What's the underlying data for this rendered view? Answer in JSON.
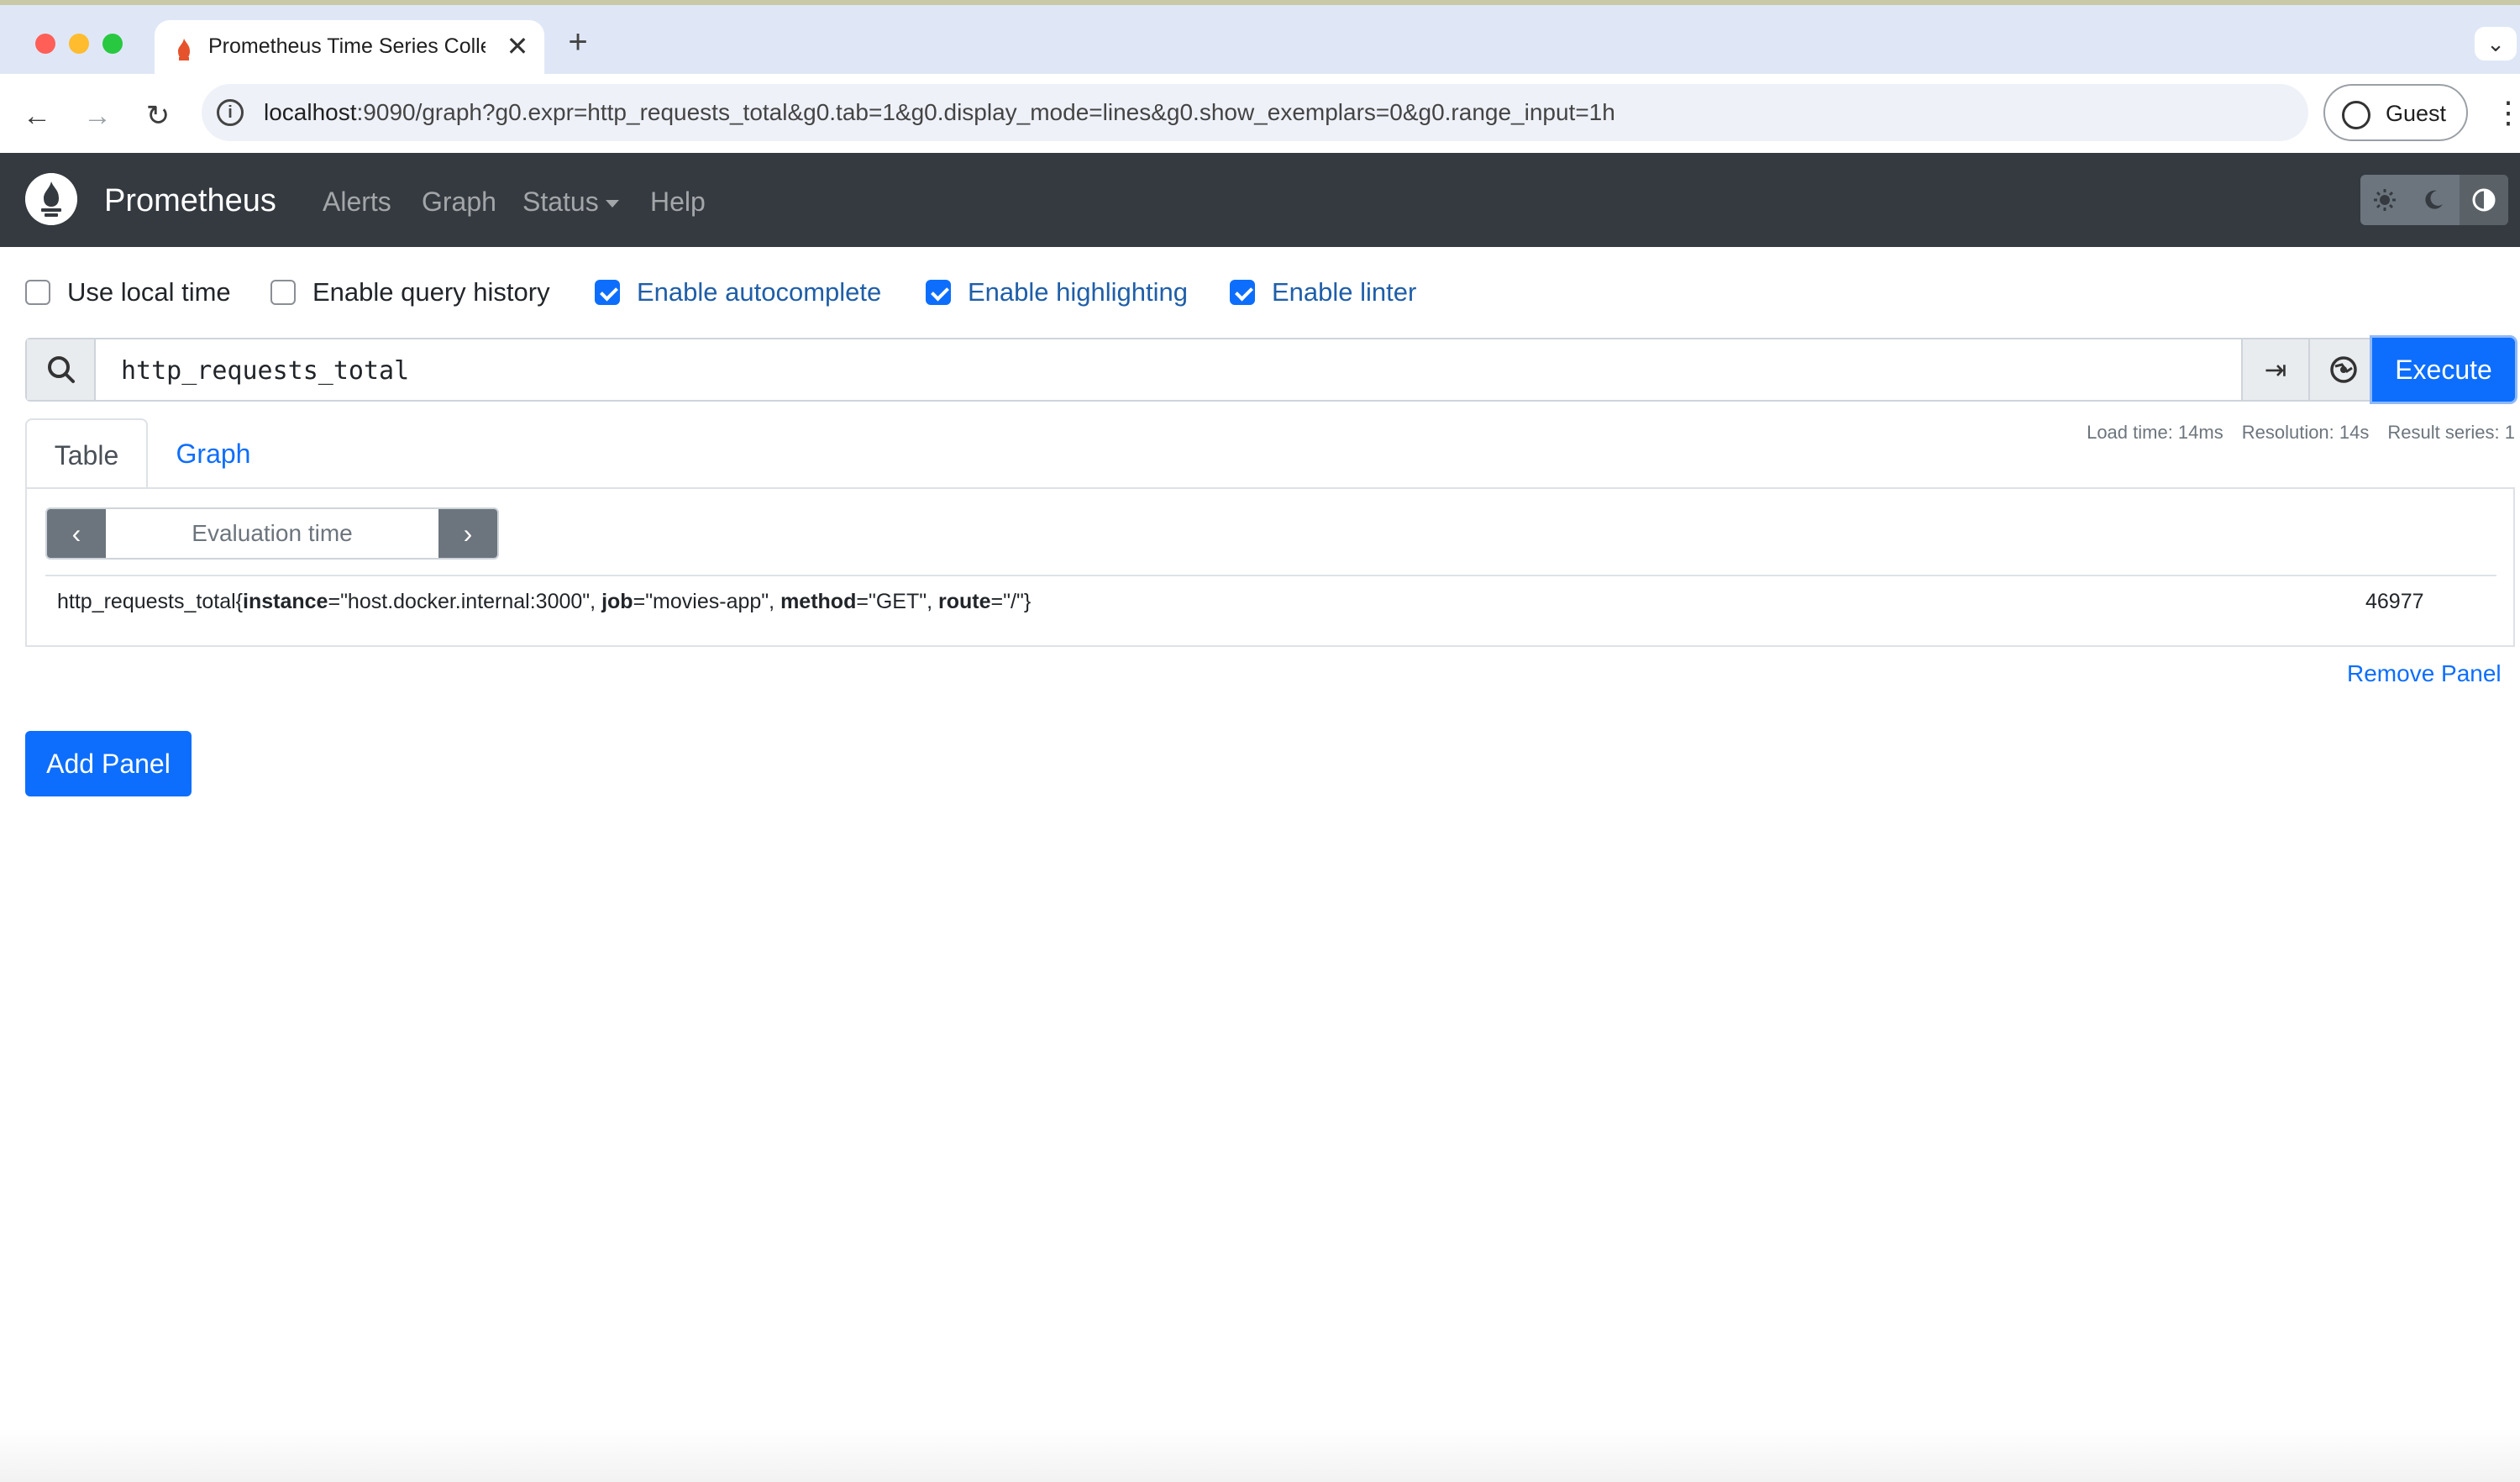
{
  "browser": {
    "tab_title": "Prometheus Time Series Collection and Processing Server",
    "tab_close": "✕",
    "new_tab": "+",
    "tab_menu": "⌄",
    "url_host": "localhost",
    "url_rest": ":9090/graph?g0.expr=http_requests_total&g0.tab=1&g0.display_mode=lines&g0.show_exemplars=0&g0.range_input=1h",
    "profile_label": "Guest",
    "info_glyph": "i",
    "menu_glyph": "⋮",
    "back_glyph": "←",
    "forward_glyph": "→",
    "reload_glyph": "↻"
  },
  "navbar": {
    "brand": "Prometheus",
    "links": [
      "Alerts",
      "Graph",
      "Status",
      "Help"
    ],
    "theme_icons": [
      "sun-icon",
      "moon-icon",
      "contrast-icon"
    ]
  },
  "options": [
    {
      "label": "Use local time",
      "checked": false
    },
    {
      "label": "Enable query history",
      "checked": false
    },
    {
      "label": "Enable autocomplete",
      "checked": true
    },
    {
      "label": "Enable highlighting",
      "checked": true
    },
    {
      "label": "Enable linter",
      "checked": true
    }
  ],
  "query": {
    "expression": "http_requests_total",
    "format_glyph": "⇥",
    "execute_label": "Execute"
  },
  "tabs": {
    "table": "Table",
    "graph": "Graph"
  },
  "stats": {
    "load_time": "Load time: 14ms",
    "resolution": "Resolution: 14s",
    "result_series": "Result series: 1"
  },
  "table": {
    "eval_placeholder": "Evaluation time",
    "prev_glyph": "‹",
    "next_glyph": "›",
    "rows": [
      {
        "metric": "http_requests_total",
        "labels": [
          {
            "name": "instance",
            "value": "\"host.docker.internal:3000\""
          },
          {
            "name": "job",
            "value": "\"movies-app\""
          },
          {
            "name": "method",
            "value": "\"GET\""
          },
          {
            "name": "route",
            "value": "\"/\""
          }
        ],
        "value": "46977"
      }
    ]
  },
  "panel": {
    "remove_label": "Remove Panel",
    "add_label": "Add Panel"
  },
  "colors": {
    "navbar_bg": "#343a40",
    "primary": "#0d6efd"
  }
}
